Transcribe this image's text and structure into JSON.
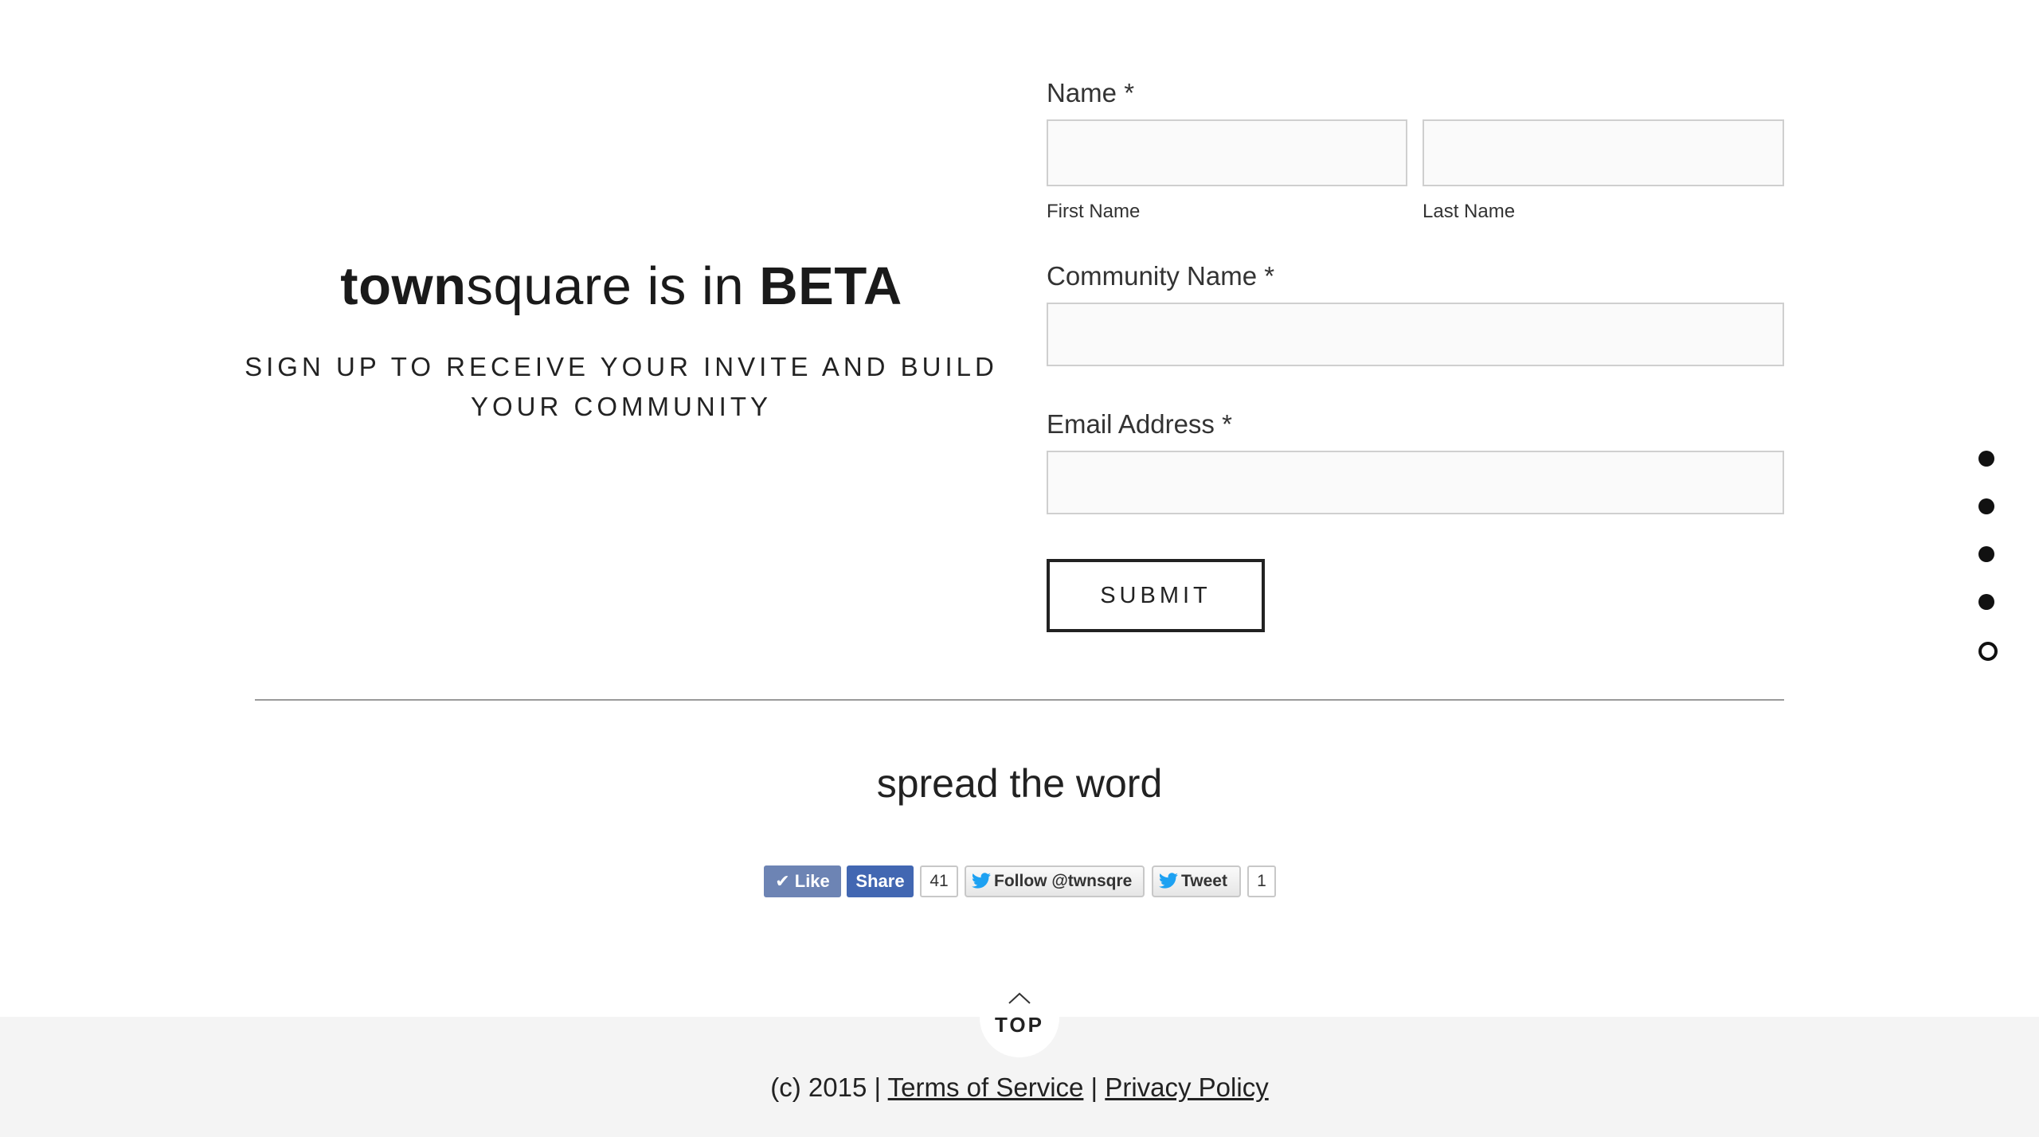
{
  "hero": {
    "title_bold": "town",
    "title_light": "square is in ",
    "title_beta": "BETA",
    "subtitle": "SIGN UP TO RECEIVE YOUR INVITE AND BUILD YOUR COMMUNITY"
  },
  "form": {
    "name_label": "Name *",
    "first_name_label": "First Name",
    "last_name_label": "Last Name",
    "community_label": "Community Name *",
    "email_label": "Email Address *",
    "first_name_value": "",
    "last_name_value": "",
    "community_value": "",
    "email_value": "",
    "submit_label": "SUBMIT"
  },
  "nav_dots": {
    "count": 5,
    "active_index": 4
  },
  "share": {
    "heading": "spread the word",
    "like_label": "Like",
    "share_label": "Share",
    "fb_count": "41",
    "follow_label": "Follow @twnsqre",
    "tweet_label": "Tweet",
    "tweet_count": "1"
  },
  "footer": {
    "top_label": "TOP",
    "copyright": "(c) 2015 | ",
    "terms_label": "Terms of Service",
    "separator": " | ",
    "privacy_label": "Privacy Policy"
  },
  "colors": {
    "facebook_like": "#6d84b4",
    "facebook_share": "#4267b2",
    "twitter_blue": "#1da1f2",
    "footer_bg": "#f4f4f4",
    "input_bg": "#fafafa"
  }
}
